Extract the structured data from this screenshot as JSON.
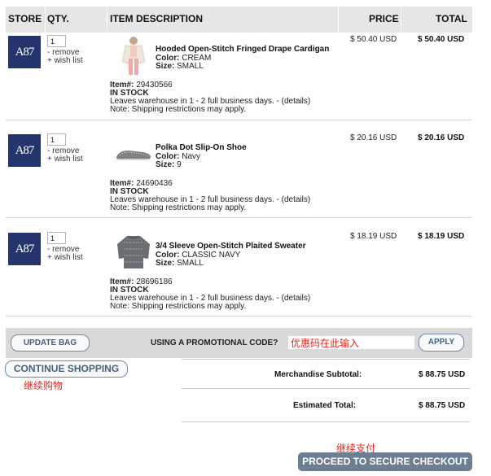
{
  "header": {
    "store": "STORE",
    "qty": "QTY.",
    "description": "ITEM DESCRIPTION",
    "price": "PRICE",
    "total": "TOTAL"
  },
  "store_logo_text": "A87",
  "items": [
    {
      "qty": "1",
      "remove": "- remove",
      "wish": "+ wish list",
      "name": "Hooded Open-Stitch Fringed Drape Cardigan",
      "color_label": "Color:",
      "color": "CREAM",
      "size_label": "Size:",
      "size": "SMALL",
      "item_label": "Item#:",
      "item_no": "29430566",
      "stock": "IN STOCK",
      "ship": "Leaves warehouse in 1 - 2 full business days. - (details)",
      "note": "Note: Shipping restrictions may apply.",
      "price": "$ 50.40 USD",
      "total": "$ 50.40  USD",
      "thumb_icon": "cardigan-thumbnail"
    },
    {
      "qty": "1",
      "remove": "- remove",
      "wish": "+ wish list",
      "name": "Polka Dot Slip-On Shoe",
      "color_label": "Color:",
      "color": "Navy",
      "size_label": "Size:",
      "size": "9",
      "item_label": "Item#:",
      "item_no": "24690436",
      "stock": "IN STOCK",
      "ship": "Leaves warehouse in 1 - 2 full business days. - (details)",
      "note": "Note: Shipping restrictions may apply.",
      "price": "$ 20.16 USD",
      "total": "$ 20.16  USD",
      "thumb_icon": "shoe-thumbnail"
    },
    {
      "qty": "1",
      "remove": "- remove",
      "wish": "+ wish list",
      "name": "3/4 Sleeve Open-Stitch Plaited Sweater",
      "color_label": "Color:",
      "color": "CLASSIC NAVY",
      "size_label": "Size:",
      "size": "SMALL",
      "item_label": "Item#:",
      "item_no": "28696186",
      "stock": "IN STOCK",
      "ship": "Leaves warehouse in 1 - 2 full business days. - (details)",
      "note": "Note: Shipping restrictions may apply.",
      "price": "$ 18.19 USD",
      "total": "$ 18.19  USD",
      "thumb_icon": "sweater-thumbnail"
    }
  ],
  "promo": {
    "update_bag": "UPDATE BAG",
    "label": "USING A PROMOTIONAL CODE?",
    "input_value": "优惠码在此输入",
    "apply": "APPLY"
  },
  "continue_shopping": "CONTINUE SHOPPING",
  "continue_note": "继续购物",
  "summary": {
    "subtotal_label": "Merchandise Subtotal:",
    "subtotal_value": "$ 88.75  USD",
    "estimated_label": "Estimated Total:",
    "estimated_value": "$ 88.75  USD"
  },
  "checkout_note": "继续支付",
  "checkout_button": "PROCEED TO SECURE CHECKOUT",
  "colors": {
    "header_bg": "#e6e6e6",
    "promo_bar_bg": "#d9d9d9",
    "logo_bg": "#24356d",
    "button_text": "#45607d",
    "checkout_bg": "#6d7e92",
    "annotation_red": "#e0281c"
  }
}
